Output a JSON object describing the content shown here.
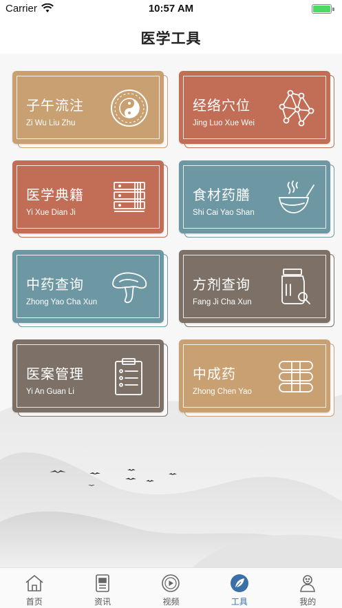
{
  "status_bar": {
    "carrier": "Carrier",
    "time": "10:57 AM"
  },
  "header": {
    "title": "医学工具"
  },
  "tools": [
    {
      "title": "子午流注",
      "subtitle": "Zi Wu Liu Zhu",
      "color": "#c9a071",
      "icon": "yin-yang-icon"
    },
    {
      "title": "经络穴位",
      "subtitle": "Jing Luo Xue Wei",
      "color": "#c26d55",
      "icon": "meridian-network-icon"
    },
    {
      "title": "医学典籍",
      "subtitle": "Yi Xue Dian Ji",
      "color": "#c26d55",
      "icon": "books-icon"
    },
    {
      "title": "食材药膳",
      "subtitle": "Shi Cai Yao Shan",
      "color": "#6d97a3",
      "icon": "bowl-icon"
    },
    {
      "title": "中药查询",
      "subtitle": "Zhong Yao Cha Xun",
      "color": "#6d97a3",
      "icon": "mushroom-icon"
    },
    {
      "title": "方剂查询",
      "subtitle": "Fang Ji Cha Xun",
      "color": "#7d7167",
      "icon": "medicine-jar-icon"
    },
    {
      "title": "医案管理",
      "subtitle": "Yi An Guan Li",
      "color": "#7d7167",
      "icon": "clipboard-icon"
    },
    {
      "title": "中成药",
      "subtitle": "Zhong Chen Yao",
      "color": "#c9a071",
      "icon": "pills-icon"
    }
  ],
  "tab_bar": {
    "tabs": [
      {
        "label": "首页",
        "icon": "home-icon"
      },
      {
        "label": "资讯",
        "icon": "news-icon"
      },
      {
        "label": "视频",
        "icon": "video-icon"
      },
      {
        "label": "工具",
        "icon": "tools-leaf-icon",
        "active": true
      },
      {
        "label": "我的",
        "icon": "profile-icon"
      }
    ],
    "active_color": "#3a6fa8",
    "inactive_color": "#555555"
  }
}
